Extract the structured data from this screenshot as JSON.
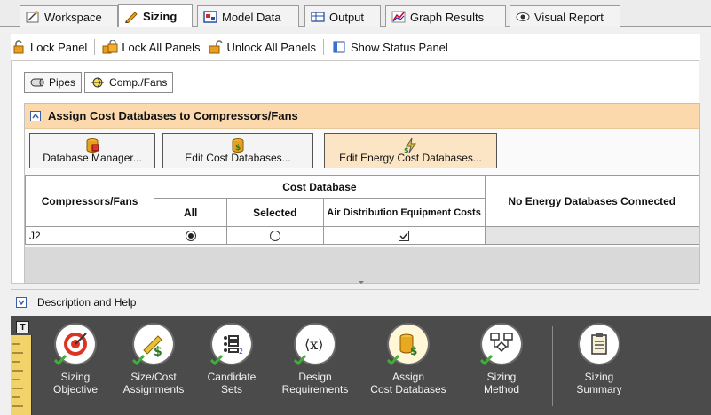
{
  "tabs": [
    {
      "label": "Workspace",
      "icon": "workspace-icon"
    },
    {
      "label": "Sizing",
      "icon": "pencil-ruler-icon",
      "active": true
    },
    {
      "label": "Model Data",
      "icon": "model-data-icon"
    },
    {
      "label": "Output",
      "icon": "table-icon"
    },
    {
      "label": "Graph Results",
      "icon": "graph-icon"
    },
    {
      "label": "Visual Report",
      "icon": "eye-icon"
    }
  ],
  "toolbar": {
    "lock_panel": "Lock Panel",
    "lock_all_panels": "Lock All Panels",
    "unlock_all_panels": "Unlock All Panels",
    "show_status_panel": "Show Status Panel"
  },
  "subtabs": {
    "pipes": "Pipes",
    "comp_fans": "Comp./Fans"
  },
  "section": {
    "title": "Assign Cost Databases to Compressors/Fans",
    "buttons": {
      "database_manager": "Database Manager...",
      "edit_cost_databases": "Edit Cost Databases...",
      "edit_energy_cost_databases": "Edit Energy Cost Databases..."
    }
  },
  "grid": {
    "col_compressors": "Compressors/Fans",
    "col_cost_database": "Cost Database",
    "col_all": "All",
    "col_selected": "Selected",
    "col_air_dist": "Air Distribution Equipment Costs",
    "col_no_energy": "No Energy Databases Connected",
    "rows": [
      {
        "name": "J2",
        "all": true,
        "selected": false,
        "air_dist": true
      }
    ]
  },
  "description": {
    "label": "Description and Help"
  },
  "bottom_tools": [
    {
      "label_line1": "Sizing",
      "label_line2": "Objective",
      "icon": "target-icon"
    },
    {
      "label_line1": "Size/Cost",
      "label_line2": "Assignments",
      "icon": "ruler-dollar-icon"
    },
    {
      "label_line1": "Candidate",
      "label_line2": "Sets",
      "icon": "list-icon"
    },
    {
      "label_line1": "Design",
      "label_line2": "Requirements",
      "icon": "variable-x-icon"
    },
    {
      "label_line1": "Assign",
      "label_line2": "Cost Databases",
      "icon": "database-dollar-icon",
      "active": true
    },
    {
      "label_line1": "Sizing",
      "label_line2": "Method",
      "icon": "flowchart-icon"
    },
    {
      "label_line1": "Sizing",
      "label_line2": "Summary",
      "icon": "clipboard-icon"
    }
  ],
  "colors": {
    "section_header": "#fbd9ad",
    "highlight_button": "#fbe5c4",
    "bottom_bar": "#4b4b4b",
    "check_green": "#3fae3a"
  }
}
